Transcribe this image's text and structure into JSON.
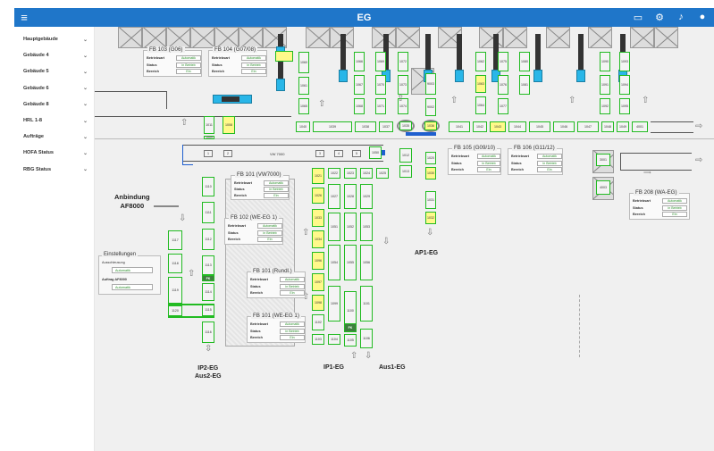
{
  "appbar": {
    "title": "EG",
    "menu_icon": "menu-icon",
    "actions": [
      "monitor-icon",
      "settings-icon",
      "notifications-icon",
      "account-icon"
    ]
  },
  "sidebar": {
    "items": [
      {
        "label": "Hauptgebäude"
      },
      {
        "label": "Gebäude 4"
      },
      {
        "label": "Gebäude 5"
      },
      {
        "label": "Gebäude 6"
      },
      {
        "label": "Gebäude 8"
      },
      {
        "label": "HRL 1-8"
      },
      {
        "label": "Aufträge"
      },
      {
        "label": "HOFA Status"
      },
      {
        "label": "RBG Status"
      }
    ]
  },
  "fb_common": {
    "betriebsart": "Betriebsart",
    "status": "Status",
    "bereich": "Bereich",
    "automatik": "Automatik",
    "in_betrieb": "in Betrieb",
    "ein": "Ein"
  },
  "fboxes": {
    "fb103": {
      "title": "FB 103 (G06)"
    },
    "fb104": {
      "title": "FB 104 (G07/08)"
    },
    "fb101vw": {
      "title": "FB 101 (VW7000)"
    },
    "fb102": {
      "title": "FB 102 (WE-EG 1)"
    },
    "fb101r": {
      "title": "FB 101 (Rundl.)"
    },
    "fb101we": {
      "title": "FB 101 (WE-EG 1)"
    },
    "fb105": {
      "title": "FB 105 (G09/10)"
    },
    "fb106": {
      "title": "FB 106 (G11/12)"
    },
    "fb208": {
      "title": "FB 208 (WA-EG)"
    }
  },
  "labels": {
    "anbindung": "Anbindung",
    "af8000": "AF8000",
    "ap1": "AP1-EG",
    "ip2": "IP2-EG",
    "aus2": "Aus2-EG",
    "ip1": "IP1-EG",
    "aus1": "Aus1-EG",
    "vw7000": "VW 7000",
    "conv_nums": [
      "1",
      "2",
      "3",
      "4",
      "5"
    ]
  },
  "settings": {
    "title": "Einstellungen",
    "ausschleusung": "Ausschleusung",
    "ausschleusung_value": "Automatik",
    "auftrag": "Auftrag AF8000",
    "auftrag_value": "Automatik"
  },
  "slots": {
    "s1060": "1060",
    "s1061": "1061",
    "s1065": "1065",
    "s1066": "1066",
    "s1067": "1067",
    "s1068": "1068",
    "s1069": "1069",
    "s1080": "1080",
    "s1081": "1081",
    "s1012": "1012",
    "s1013": "1013",
    "s1020": "1020",
    "s1030": "1030",
    "s1031": "1031",
    "s1032": "1032",
    "s1033": "1033",
    "s1034": "1034",
    "s1035": "1035",
    "s1036": "1036",
    "s1037": "1037",
    "s1038": "1038",
    "s1039": "1039",
    "s1040": "1040",
    "s1041": "1041",
    "s1042": "1042",
    "s1043": "1043",
    "s1044": "1044",
    "s1045": "1045",
    "s1046": "1046",
    "s1047": "1047",
    "s1048": "1048",
    "s1049": "1049",
    "s4001": "4001",
    "s1050": "1050",
    "s1051": "1051",
    "s1052": "1052",
    "s1053": "1053",
    "s1054": "1054",
    "s1055": "1055",
    "s1056": "1056",
    "s1062": "1062",
    "s1063": "1063",
    "s1064": "1064",
    "s1070": "1070",
    "s1071": "1071",
    "s1072": "1072",
    "s1073": "1073",
    "s1074": "1074",
    "s1075": "1075",
    "s1076": "1076",
    "s1077": "1077",
    "s1090": "1090",
    "s1091": "1091",
    "s1092": "1092",
    "s1093": "1093",
    "s1094": "1094",
    "s1095": "1095",
    "s3001": "3001",
    "s4003": "4003",
    "s1110": "1110",
    "s1111": "1111",
    "s1112": "1112",
    "s1113": "1113",
    "s1114": "1114",
    "s1115": "1115",
    "s1116": "1116",
    "s1117": "1117",
    "s1118": "1118",
    "s1119": "1119",
    "s1001": "1001",
    "s1002": "1002",
    "s1003": "1003",
    "s1004": "1004",
    "s1005": "1005",
    "s1008": "1008",
    "s1009": "1009",
    "s1021": "1021",
    "s1022": "1022",
    "s1023": "1023",
    "s1024": "1024",
    "s1025": "1025",
    "s1026": "1026",
    "s1027": "1027",
    "s1028": "1028",
    "s1029": "1029",
    "s1096": "1096",
    "s1097": "1097",
    "s1098": "1098",
    "s1099": "1099",
    "s1100": "1100",
    "s1101": "1101",
    "s1102": "1102",
    "s1103": "1103",
    "s1104": "1104",
    "s1105": "1105",
    "s1106": "1106",
    "s1107": "1107",
    "s1108": "1108",
    "s1109": "1109",
    "s1120": "1120",
    "s1121": "1121",
    "s1122": "1122",
    "s1123": "1123",
    "s9003": "9003",
    "s9002": "9002",
    "s1011": "1011",
    "fk": "FK"
  }
}
